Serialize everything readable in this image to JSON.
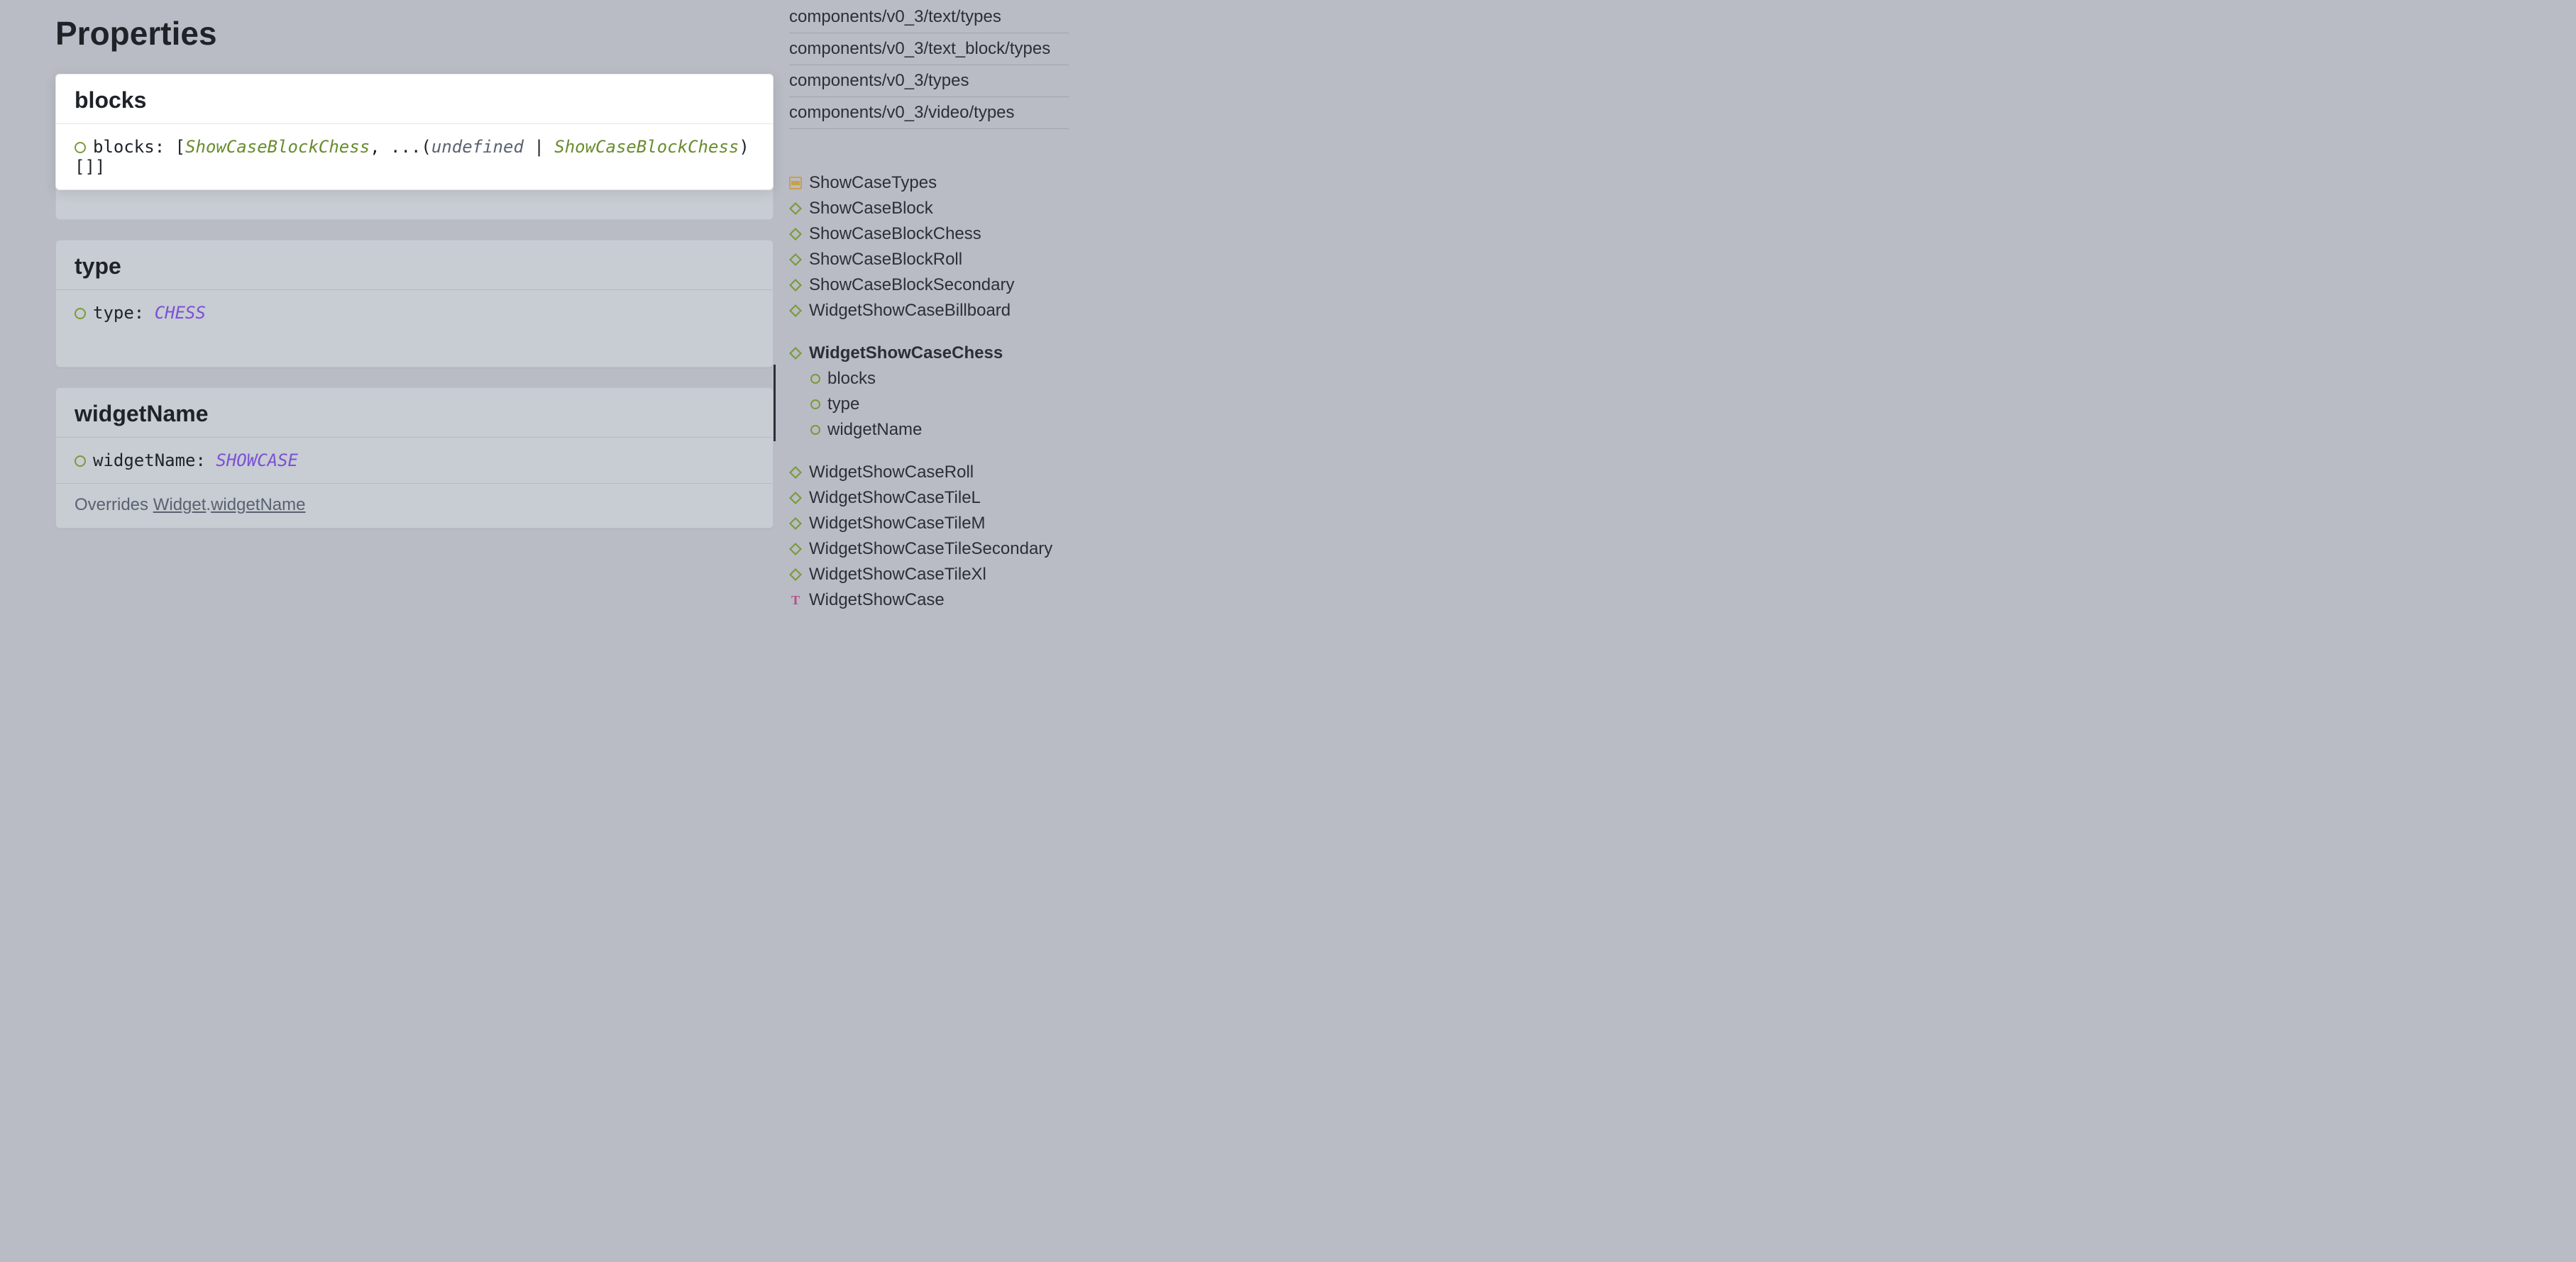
{
  "section_title": "Properties",
  "properties": [
    {
      "name": "blocks",
      "highlighted": true,
      "sig_name": "blocks",
      "sig_parts": [
        {
          "t": "punc",
          "v": ": ["
        },
        {
          "t": "type",
          "v": "ShowCaseBlockChess"
        },
        {
          "t": "punc",
          "v": ", ...("
        },
        {
          "t": "undef",
          "v": "undefined"
        },
        {
          "t": "punc",
          "v": " | "
        },
        {
          "t": "type",
          "v": "ShowCaseBlockChess"
        },
        {
          "t": "punc",
          "v": ")[]]"
        }
      ],
      "overrides": null
    },
    {
      "name": "type",
      "highlighted": false,
      "sig_name": "type",
      "sig_parts": [
        {
          "t": "punc",
          "v": ": "
        },
        {
          "t": "const",
          "v": "CHESS"
        }
      ],
      "overrides": null
    },
    {
      "name": "widgetName",
      "highlighted": false,
      "sig_name": "widgetName",
      "sig_parts": [
        {
          "t": "punc",
          "v": ": "
        },
        {
          "t": "const",
          "v": "SHOWCASE"
        }
      ],
      "overrides": {
        "prefix": "Overrides ",
        "link1": "Widget",
        "sep": ".",
        "link2": "widgetName"
      }
    }
  ],
  "sidebar": {
    "paths": [
      "components/v0_3/text/types",
      "components/v0_3/text_block/types",
      "components/v0_3/types",
      "components/v0_3/video/types"
    ],
    "group1": [
      {
        "icon": "enum",
        "label": "ShowCaseTypes"
      },
      {
        "icon": "iface",
        "label": "ShowCaseBlock"
      },
      {
        "icon": "iface",
        "label": "ShowCaseBlockChess"
      },
      {
        "icon": "iface",
        "label": "ShowCaseBlockRoll"
      },
      {
        "icon": "iface",
        "label": "ShowCaseBlockSecondary"
      },
      {
        "icon": "iface",
        "label": "WidgetShowCaseBillboard"
      }
    ],
    "active": {
      "head": {
        "icon": "iface",
        "label": "WidgetShowCaseChess"
      },
      "members": [
        {
          "icon": "circle",
          "label": "blocks"
        },
        {
          "icon": "circle",
          "label": "type"
        },
        {
          "icon": "circle",
          "label": "widgetName"
        }
      ]
    },
    "group2": [
      {
        "icon": "iface",
        "label": "WidgetShowCaseRoll"
      },
      {
        "icon": "iface",
        "label": "WidgetShowCaseTileL"
      },
      {
        "icon": "iface",
        "label": "WidgetShowCaseTileM"
      },
      {
        "icon": "iface",
        "label": "WidgetShowCaseTileSecondary"
      },
      {
        "icon": "iface",
        "label": "WidgetShowCaseTileXl"
      },
      {
        "icon": "type",
        "label": "WidgetShowCase"
      }
    ]
  }
}
